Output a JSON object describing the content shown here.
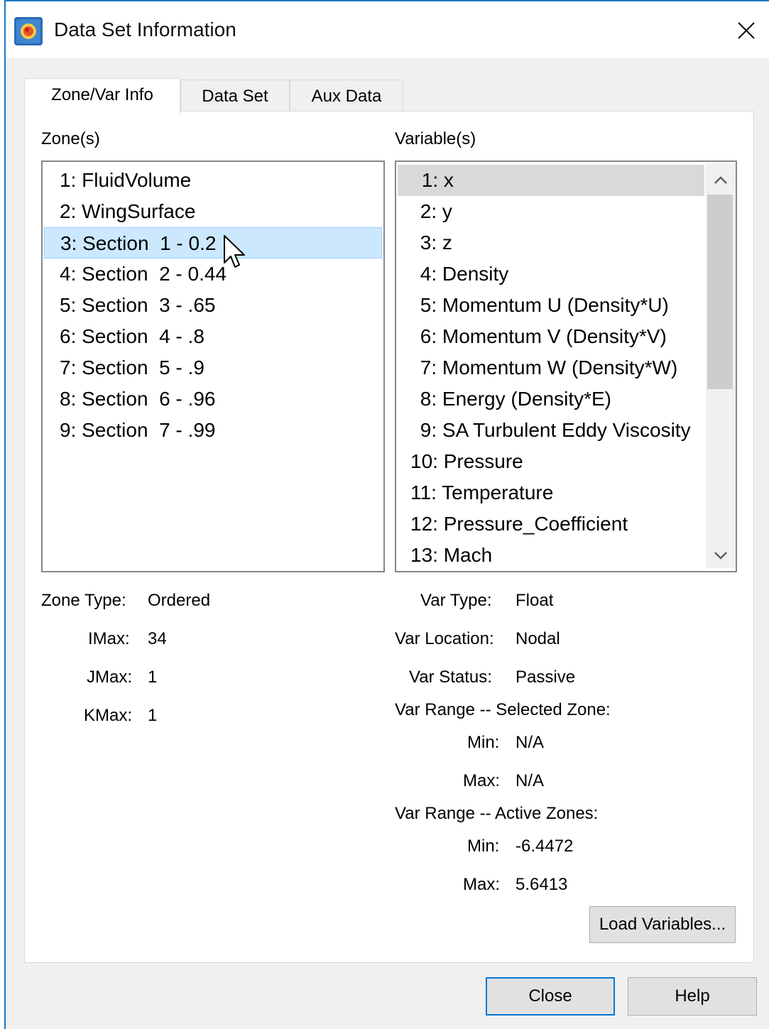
{
  "window": {
    "title": "Data Set Information",
    "app_icon": "tecplot-app-icon",
    "close_icon": "close-icon"
  },
  "tabs": [
    {
      "label": "Zone/Var Info",
      "active": true
    },
    {
      "label": "Data Set",
      "active": false
    },
    {
      "label": "Aux Data",
      "active": false
    }
  ],
  "zones": {
    "header": "Zone(s)",
    "items": [
      "1: FluidVolume",
      "2: WingSurface",
      "3: Section  1 - 0.2",
      "4: Section  2 - 0.44",
      "5: Section  3 - .65",
      "6: Section  4 - .8",
      "7: Section  5 - .9",
      "8: Section  6 - .96",
      "9: Section  7 - .99"
    ],
    "selected_index": 2
  },
  "variables": {
    "header": "Variable(s)",
    "items": [
      " 1: x",
      " 2: y",
      " 3: z",
      " 4: Density",
      " 5: Momentum U (Density*U)",
      " 6: Momentum V (Density*V)",
      " 7: Momentum W (Density*W)",
      " 8: Energy (Density*E)",
      " 9: SA Turbulent Eddy Viscosity",
      "10: Pressure",
      "11: Temperature",
      "12: Pressure_Coefficient",
      "13: Mach"
    ],
    "selected_index": 0
  },
  "zone_info": {
    "zone_type_label": "Zone Type:",
    "zone_type_value": "Ordered",
    "imax_label": "IMax:",
    "imax_value": "34",
    "jmax_label": "JMax:",
    "jmax_value": "1",
    "kmax_label": "KMax:",
    "kmax_value": "1"
  },
  "var_info": {
    "var_type_label": "Var Type:",
    "var_type_value": "Float",
    "var_location_label": "Var Location:",
    "var_location_value": "Nodal",
    "var_status_label": "Var Status:",
    "var_status_value": "Passive",
    "range_selected_heading": "Var Range -- Selected Zone:",
    "sel_min_label": "Min:",
    "sel_min_value": "N/A",
    "sel_max_label": "Max:",
    "sel_max_value": "N/A",
    "range_active_heading": "Var Range -- Active Zones:",
    "act_min_label": "Min:",
    "act_min_value": "-6.4472",
    "act_max_label": "Max:",
    "act_max_value": "5.6413"
  },
  "buttons": {
    "load_variables": "Load Variables...",
    "close": "Close",
    "help": "Help"
  },
  "colors": {
    "window_border": "#1979ca",
    "zone_selection": "#cce8ff",
    "default_button_border": "#0078d7"
  }
}
